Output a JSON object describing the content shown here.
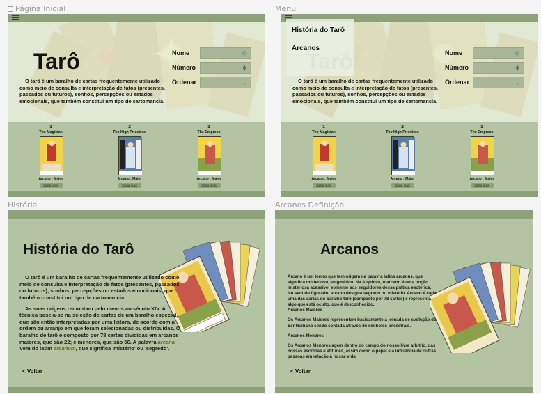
{
  "frames": {
    "home": "Página Inicial",
    "menu": "Menu",
    "history": "História",
    "arcanos": "Arcanos Definição"
  },
  "home": {
    "title": "Tarô",
    "description": "O tarô é um baralho de cartas frequentemente utilizado como meio de consulta e interpretação de fatos (presentes, passados ou futuros), sonhos, percepções ou estados emocionais, que também constitui um tipo de cartomancia.",
    "form": {
      "nome_label": "Nome",
      "numero_label": "Número",
      "ordenar_label": "Ordenar"
    },
    "cards": [
      {
        "number": "1",
        "name": "The Magician",
        "type": "Arcano : Major",
        "button": "Saiba mais"
      },
      {
        "number": "2",
        "name": "The High Priestess",
        "type": "Arcano : Major",
        "button": "Saiba mais"
      },
      {
        "number": "3",
        "name": "The Empress",
        "type": "Arcano : Major",
        "button": "Saiba mais"
      }
    ]
  },
  "menu": {
    "items": [
      "História do Tarô",
      "Arcanos"
    ]
  },
  "history": {
    "title": "História do Tarô",
    "p1": "O tarô é um baralho de cartas frequentemente utilizado como meio de consulta e interpretação de fatos (presentes, passados ou futuros), sonhos, percepções ou estados emocionais, que também constitui um tipo de cartomancia.",
    "p2_a": "As suas origens remontam pelo menos ao século XIV. A técnica baseia-se na seleção de cartas de um baralho especial, que são então interpretadas por uma leitora, de acordo com a ordem ou arranjo em que foram selecionadas ou distribuídas. O baralho de tarô é composto por 78 cartas divididas em arcanos maiores, que são 22; e menores, que são 56. A palavra",
    "word1": "arcana",
    "p2_b": "Vem do latim",
    "word2": "arcanum",
    "p2_c": ", que significa 'mistério' ou 'segredo'.",
    "back": "< Voltar"
  },
  "arcanos": {
    "title": "Arcanos",
    "p1": "Arcano é um termo que tem origem na palavra latina arcanus, que significa misterioso, enigmático. Na Alquimia, o arcano é uma poção misteriosa acessível somente aos seguidores dessa prática esotérica. No sentido figurado, arcano designa segredo ou mistério. Arcano é cada uma das cartas do baralho tarô (composto por 78 cartas) e representa algo que está oculto, que é desconhecido.",
    "p1_tail": "Arcanos Maiores",
    "p2": "Os Arcanos Maiores representam basicamente a jornada de evolução do Ser Humano sendo contada através de símbolos ancestrais.",
    "p3": "Arcanos Menores",
    "p4": "Os Arcanos Menores agem dentro do campo do nosso livre arbítrio, das nossas escolhas e atitudes, assim como o papel e a influência de outras pessoas em relação à nossa vida.",
    "back": "< Voltar"
  },
  "colors": {
    "bg": "#b4c3a2",
    "bar": "#8ea27a",
    "hero": "#dfe7d3"
  }
}
